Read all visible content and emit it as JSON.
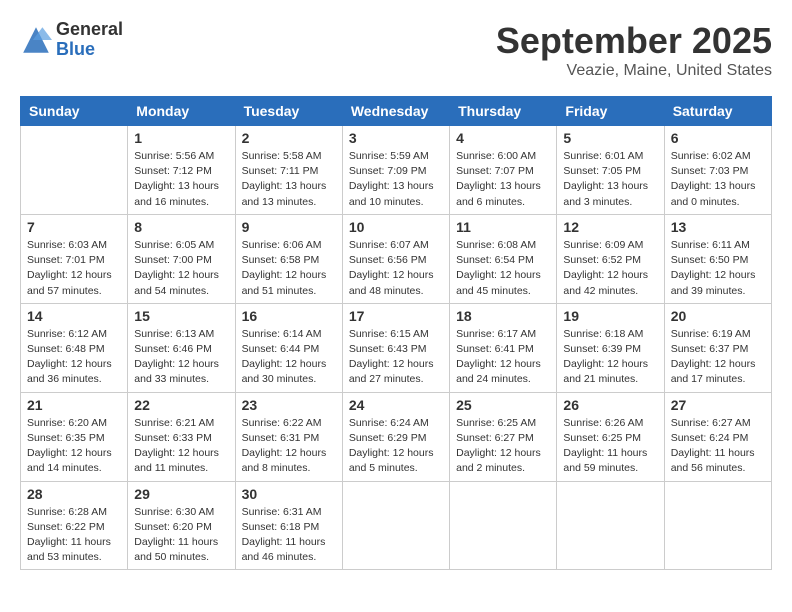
{
  "header": {
    "logo": {
      "general": "General",
      "blue": "Blue"
    },
    "title": "September 2025",
    "location": "Veazie, Maine, United States"
  },
  "weekdays": [
    "Sunday",
    "Monday",
    "Tuesday",
    "Wednesday",
    "Thursday",
    "Friday",
    "Saturday"
  ],
  "weeks": [
    [
      {
        "day": "",
        "sunrise": "",
        "sunset": "",
        "daylight": ""
      },
      {
        "day": "1",
        "sunrise": "Sunrise: 5:56 AM",
        "sunset": "Sunset: 7:12 PM",
        "daylight": "Daylight: 13 hours and 16 minutes."
      },
      {
        "day": "2",
        "sunrise": "Sunrise: 5:58 AM",
        "sunset": "Sunset: 7:11 PM",
        "daylight": "Daylight: 13 hours and 13 minutes."
      },
      {
        "day": "3",
        "sunrise": "Sunrise: 5:59 AM",
        "sunset": "Sunset: 7:09 PM",
        "daylight": "Daylight: 13 hours and 10 minutes."
      },
      {
        "day": "4",
        "sunrise": "Sunrise: 6:00 AM",
        "sunset": "Sunset: 7:07 PM",
        "daylight": "Daylight: 13 hours and 6 minutes."
      },
      {
        "day": "5",
        "sunrise": "Sunrise: 6:01 AM",
        "sunset": "Sunset: 7:05 PM",
        "daylight": "Daylight: 13 hours and 3 minutes."
      },
      {
        "day": "6",
        "sunrise": "Sunrise: 6:02 AM",
        "sunset": "Sunset: 7:03 PM",
        "daylight": "Daylight: 13 hours and 0 minutes."
      }
    ],
    [
      {
        "day": "7",
        "sunrise": "Sunrise: 6:03 AM",
        "sunset": "Sunset: 7:01 PM",
        "daylight": "Daylight: 12 hours and 57 minutes."
      },
      {
        "day": "8",
        "sunrise": "Sunrise: 6:05 AM",
        "sunset": "Sunset: 7:00 PM",
        "daylight": "Daylight: 12 hours and 54 minutes."
      },
      {
        "day": "9",
        "sunrise": "Sunrise: 6:06 AM",
        "sunset": "Sunset: 6:58 PM",
        "daylight": "Daylight: 12 hours and 51 minutes."
      },
      {
        "day": "10",
        "sunrise": "Sunrise: 6:07 AM",
        "sunset": "Sunset: 6:56 PM",
        "daylight": "Daylight: 12 hours and 48 minutes."
      },
      {
        "day": "11",
        "sunrise": "Sunrise: 6:08 AM",
        "sunset": "Sunset: 6:54 PM",
        "daylight": "Daylight: 12 hours and 45 minutes."
      },
      {
        "day": "12",
        "sunrise": "Sunrise: 6:09 AM",
        "sunset": "Sunset: 6:52 PM",
        "daylight": "Daylight: 12 hours and 42 minutes."
      },
      {
        "day": "13",
        "sunrise": "Sunrise: 6:11 AM",
        "sunset": "Sunset: 6:50 PM",
        "daylight": "Daylight: 12 hours and 39 minutes."
      }
    ],
    [
      {
        "day": "14",
        "sunrise": "Sunrise: 6:12 AM",
        "sunset": "Sunset: 6:48 PM",
        "daylight": "Daylight: 12 hours and 36 minutes."
      },
      {
        "day": "15",
        "sunrise": "Sunrise: 6:13 AM",
        "sunset": "Sunset: 6:46 PM",
        "daylight": "Daylight: 12 hours and 33 minutes."
      },
      {
        "day": "16",
        "sunrise": "Sunrise: 6:14 AM",
        "sunset": "Sunset: 6:44 PM",
        "daylight": "Daylight: 12 hours and 30 minutes."
      },
      {
        "day": "17",
        "sunrise": "Sunrise: 6:15 AM",
        "sunset": "Sunset: 6:43 PM",
        "daylight": "Daylight: 12 hours and 27 minutes."
      },
      {
        "day": "18",
        "sunrise": "Sunrise: 6:17 AM",
        "sunset": "Sunset: 6:41 PM",
        "daylight": "Daylight: 12 hours and 24 minutes."
      },
      {
        "day": "19",
        "sunrise": "Sunrise: 6:18 AM",
        "sunset": "Sunset: 6:39 PM",
        "daylight": "Daylight: 12 hours and 21 minutes."
      },
      {
        "day": "20",
        "sunrise": "Sunrise: 6:19 AM",
        "sunset": "Sunset: 6:37 PM",
        "daylight": "Daylight: 12 hours and 17 minutes."
      }
    ],
    [
      {
        "day": "21",
        "sunrise": "Sunrise: 6:20 AM",
        "sunset": "Sunset: 6:35 PM",
        "daylight": "Daylight: 12 hours and 14 minutes."
      },
      {
        "day": "22",
        "sunrise": "Sunrise: 6:21 AM",
        "sunset": "Sunset: 6:33 PM",
        "daylight": "Daylight: 12 hours and 11 minutes."
      },
      {
        "day": "23",
        "sunrise": "Sunrise: 6:22 AM",
        "sunset": "Sunset: 6:31 PM",
        "daylight": "Daylight: 12 hours and 8 minutes."
      },
      {
        "day": "24",
        "sunrise": "Sunrise: 6:24 AM",
        "sunset": "Sunset: 6:29 PM",
        "daylight": "Daylight: 12 hours and 5 minutes."
      },
      {
        "day": "25",
        "sunrise": "Sunrise: 6:25 AM",
        "sunset": "Sunset: 6:27 PM",
        "daylight": "Daylight: 12 hours and 2 minutes."
      },
      {
        "day": "26",
        "sunrise": "Sunrise: 6:26 AM",
        "sunset": "Sunset: 6:25 PM",
        "daylight": "Daylight: 11 hours and 59 minutes."
      },
      {
        "day": "27",
        "sunrise": "Sunrise: 6:27 AM",
        "sunset": "Sunset: 6:24 PM",
        "daylight": "Daylight: 11 hours and 56 minutes."
      }
    ],
    [
      {
        "day": "28",
        "sunrise": "Sunrise: 6:28 AM",
        "sunset": "Sunset: 6:22 PM",
        "daylight": "Daylight: 11 hours and 53 minutes."
      },
      {
        "day": "29",
        "sunrise": "Sunrise: 6:30 AM",
        "sunset": "Sunset: 6:20 PM",
        "daylight": "Daylight: 11 hours and 50 minutes."
      },
      {
        "day": "30",
        "sunrise": "Sunrise: 6:31 AM",
        "sunset": "Sunset: 6:18 PM",
        "daylight": "Daylight: 11 hours and 46 minutes."
      },
      {
        "day": "",
        "sunrise": "",
        "sunset": "",
        "daylight": ""
      },
      {
        "day": "",
        "sunrise": "",
        "sunset": "",
        "daylight": ""
      },
      {
        "day": "",
        "sunrise": "",
        "sunset": "",
        "daylight": ""
      },
      {
        "day": "",
        "sunrise": "",
        "sunset": "",
        "daylight": ""
      }
    ]
  ]
}
